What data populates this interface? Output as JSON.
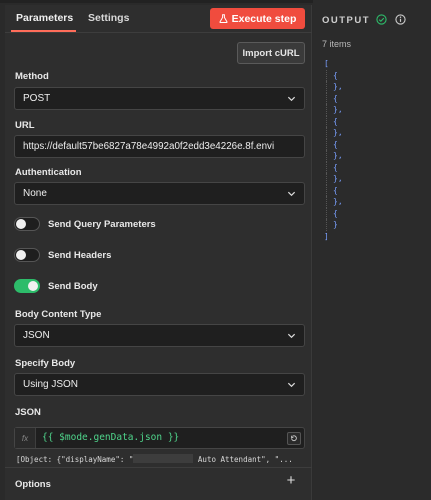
{
  "tabs": {
    "parameters": "Parameters",
    "settings": "Settings"
  },
  "toolbar": {
    "execute_label": "Execute step",
    "import_label": "Import cURL"
  },
  "method": {
    "label": "Method",
    "value": "POST"
  },
  "url": {
    "label": "URL",
    "value": "https://default57be6827a78e4992a0f2edd3e4226e.8f.envi"
  },
  "authentication": {
    "label": "Authentication",
    "value": "None"
  },
  "toggles": {
    "query": "Send Query Parameters",
    "headers": "Send Headers",
    "body": "Send Body"
  },
  "body_content_type": {
    "label": "Body Content Type",
    "value": "JSON"
  },
  "specify_body": {
    "label": "Specify Body",
    "value": "Using JSON"
  },
  "json": {
    "label": "JSON",
    "fx": "fx",
    "expression": "{{ $mode.genData.json }}",
    "preview_start": "[Object: {\"displayName\": \"",
    "preview_end": " Auto Attendant\", \"..."
  },
  "options": {
    "label": "Options",
    "add": "+"
  },
  "output": {
    "title": "OUTPUT",
    "items_count": "7 items",
    "open": "[",
    "close": "]",
    "obj_open": "{",
    "obj_close": "},",
    "obj_close_last": "}"
  },
  "colors": {
    "accent": "#ff6d5a",
    "execute": "#f04c3e",
    "toggle_on": "#2dbc6a",
    "expr": "#4fd48b",
    "json_bracket": "#7aa0ff"
  },
  "icons": {
    "execute": "flask-icon",
    "chevron": "chevron-down-icon",
    "status": "check-circle-icon",
    "info": "info-icon",
    "expand": "open-editor-icon"
  }
}
